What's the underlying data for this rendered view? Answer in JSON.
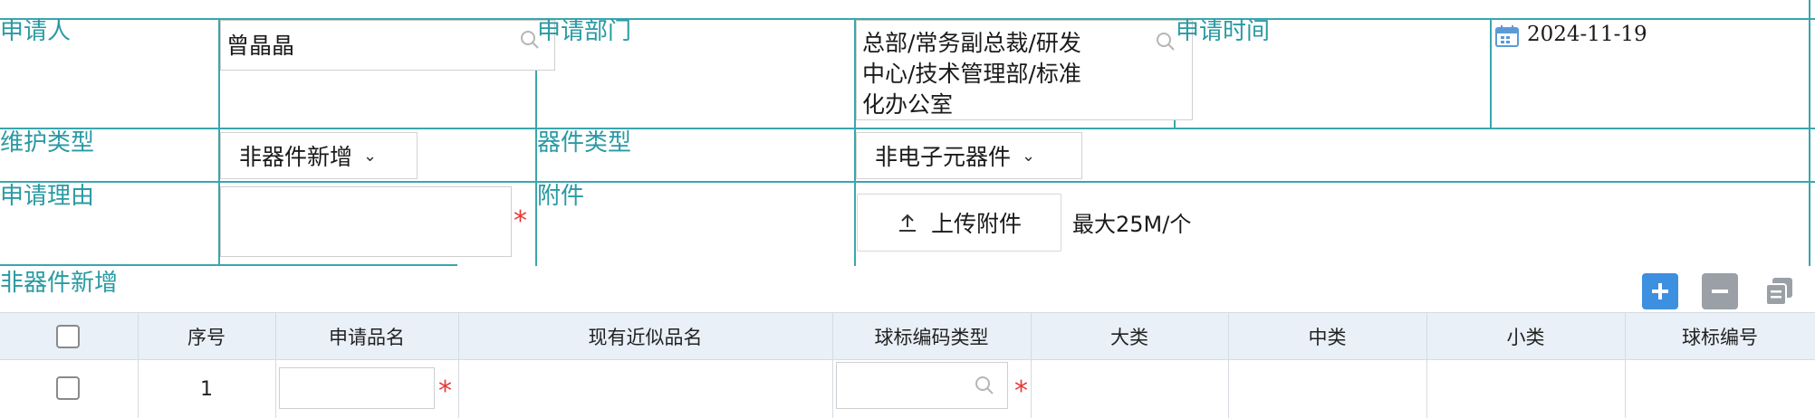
{
  "form": {
    "applicant_label": "申请人",
    "applicant_value": "曾晶晶",
    "department_label": "申请部门",
    "department_lines": [
      "总部/常务副总裁/研发",
      "中心/技术管理部/标准",
      "化办公室"
    ],
    "apply_time_label": "申请时间",
    "apply_time_value": "2024-11-19",
    "maintain_type_label": "维护类型",
    "maintain_type_value": "非器件新增",
    "device_type_label": "器件类型",
    "device_type_value": "非电子元器件",
    "reason_label": "申请理由",
    "reason_value": "",
    "attachment_label": "附件",
    "upload_label": "上传附件",
    "upload_hint": "最大25M/个"
  },
  "section": {
    "title": "非器件新增"
  },
  "table": {
    "columns": [
      "序号",
      "申请品名",
      "现有近似品名",
      "球标编码类型",
      "大类",
      "中类",
      "小类",
      "球标编号"
    ],
    "rows": [
      {
        "index": "1",
        "apply_name": "",
        "similar_name": "",
        "code_type": "",
        "major": "",
        "middle": "",
        "minor": "",
        "code_no": ""
      }
    ]
  },
  "icons": {
    "search": "search-icon",
    "calendar": "calendar-icon",
    "upload": "upload-icon",
    "add": "plus-icon",
    "remove": "minus-icon",
    "copy": "copy-icon"
  },
  "colors": {
    "label": "#2a9aa3",
    "grid_line": "#3aa6ad",
    "required": "#e53935",
    "table_header_bg": "#e9f0f8",
    "add_button": "#3d8fe0",
    "remove_button": "#9aa0a6"
  }
}
